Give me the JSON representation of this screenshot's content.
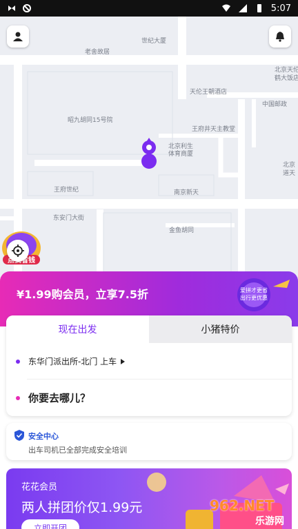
{
  "status_bar": {
    "time": "5:07"
  },
  "map": {
    "labels": {
      "shijie_dasha": "世纪大厦",
      "laoshe_guju": "老舍故居",
      "tianlun": "天伦王朝酒店",
      "beijing_tian": "北京天伦",
      "sheng_fandian": "鹤大饭店",
      "china_post": "中国邮政",
      "zhaojiu": "昭九胡同15号院",
      "church": "王府井天主教堂",
      "sports": "北京利生体育商厦",
      "wangfu": "王府世纪",
      "nanjing": "南京新天",
      "beijing_r": "北京",
      "dao_tian": "道天",
      "donganmen": "东安门大街",
      "jinyu": "金鱼胡同"
    },
    "money_badge": "点我省钱"
  },
  "promo": {
    "text": "¥1.99购会员，立享7.5折",
    "deco_line1": "爱拼才更省",
    "deco_line2": "出行更优惠"
  },
  "booking": {
    "tab_now": "现在出发",
    "tab_special": "小猪特价",
    "pickup": "东华门派出所-北门 上车",
    "destination": "你要去哪儿？"
  },
  "safety": {
    "title": "安全中心",
    "subtitle": "出车司机已全部完成安全培训"
  },
  "member": {
    "subtitle": "花花会员",
    "title": "两人拼团价仅1.99元",
    "button": "立即开团"
  },
  "watermark": {
    "brand": "962.NET",
    "sub": "乐游网"
  },
  "colors": {
    "accent": "#7b2cf0",
    "pink": "#e72bb6",
    "safety_blue": "#2a56d8"
  }
}
